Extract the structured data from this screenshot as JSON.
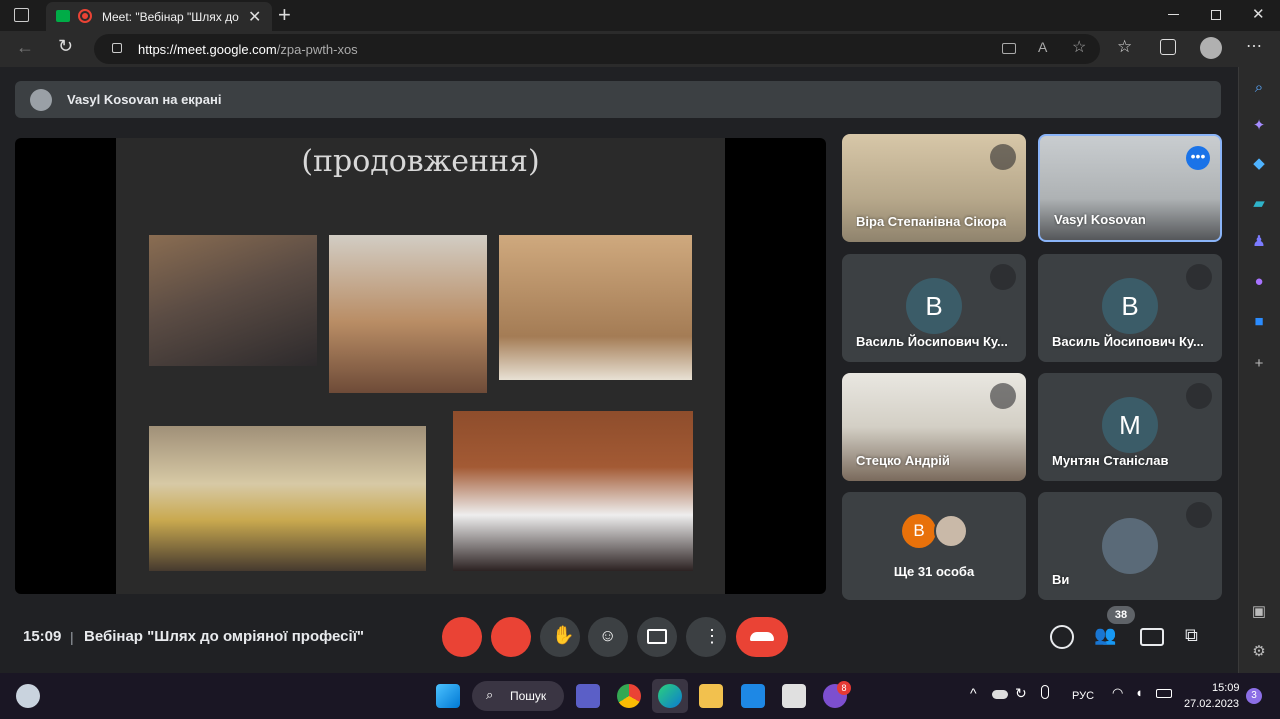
{
  "browser": {
    "tab_title": "Meet: \"Вебінар \"Шлях до о",
    "url_host": "https://meet.google.com",
    "url_path": "/zpa-pwth-xos"
  },
  "banner": {
    "text": "Vasyl Kosovan на екрані"
  },
  "slide": {
    "title": "(продовження)"
  },
  "tiles": [
    {
      "name": "Віра Степанівна Сікора"
    },
    {
      "name": "Vasyl Kosovan"
    },
    {
      "name": "Василь Йосипович Ку...",
      "initial": "В"
    },
    {
      "name": "Василь Йосипович Ку...",
      "initial": "В"
    },
    {
      "name": "Стецко Андрій"
    },
    {
      "name": "Мунтян Станіслав",
      "initial": "М"
    },
    {
      "name": "Ще 31 особа",
      "initial": "В"
    },
    {
      "name": "Ви"
    }
  ],
  "bottom": {
    "time": "15:09",
    "separator": "|",
    "meeting_title": "Вебінар \"Шлях до омріяної професії\"",
    "participants_badge": "38"
  },
  "taskbar": {
    "search_label": "Пошук",
    "lang": "РУС",
    "clock_time": "15:09",
    "clock_date": "27.02.2023",
    "notif_count": "3",
    "viber_badge": "8"
  },
  "colors": {
    "accent_blue": "#8ab4f8",
    "end_call_red": "#ea4335",
    "avatar_orange": "#e8710a",
    "avatar_teal": "#3b5c68"
  }
}
